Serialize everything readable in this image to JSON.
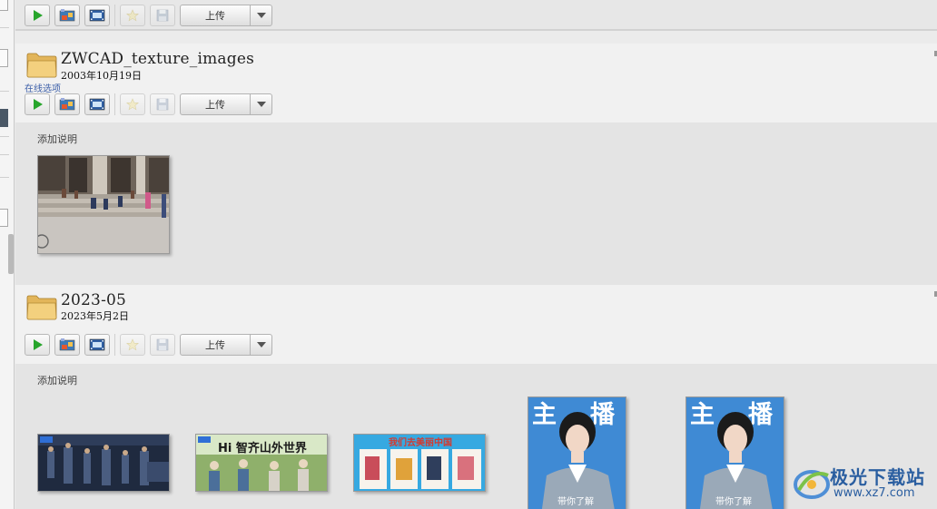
{
  "toolbar": {
    "upload_label": "上传"
  },
  "albums": [
    {
      "title": "ZWCAD_texture_images",
      "date": "2003年10月19日",
      "online_options": "在线选项",
      "description_placeholder": "添加说明"
    },
    {
      "title": "2023-05",
      "date": "2023年5月2日",
      "description_placeholder": "添加说明"
    }
  ],
  "thumbnails": {
    "anchor_caption": "带你了解",
    "anchor_title_chars": [
      "主",
      "播"
    ],
    "mountain_title": "Hi 智齐山外世界",
    "travel_title": "我们去美丽中国"
  },
  "watermark": {
    "brand": "极光下载站",
    "url": "www.xz7.com"
  },
  "colors": {
    "link": "#3b5ea8",
    "play_icon": "#27a52b",
    "background": "#ebebeb"
  }
}
